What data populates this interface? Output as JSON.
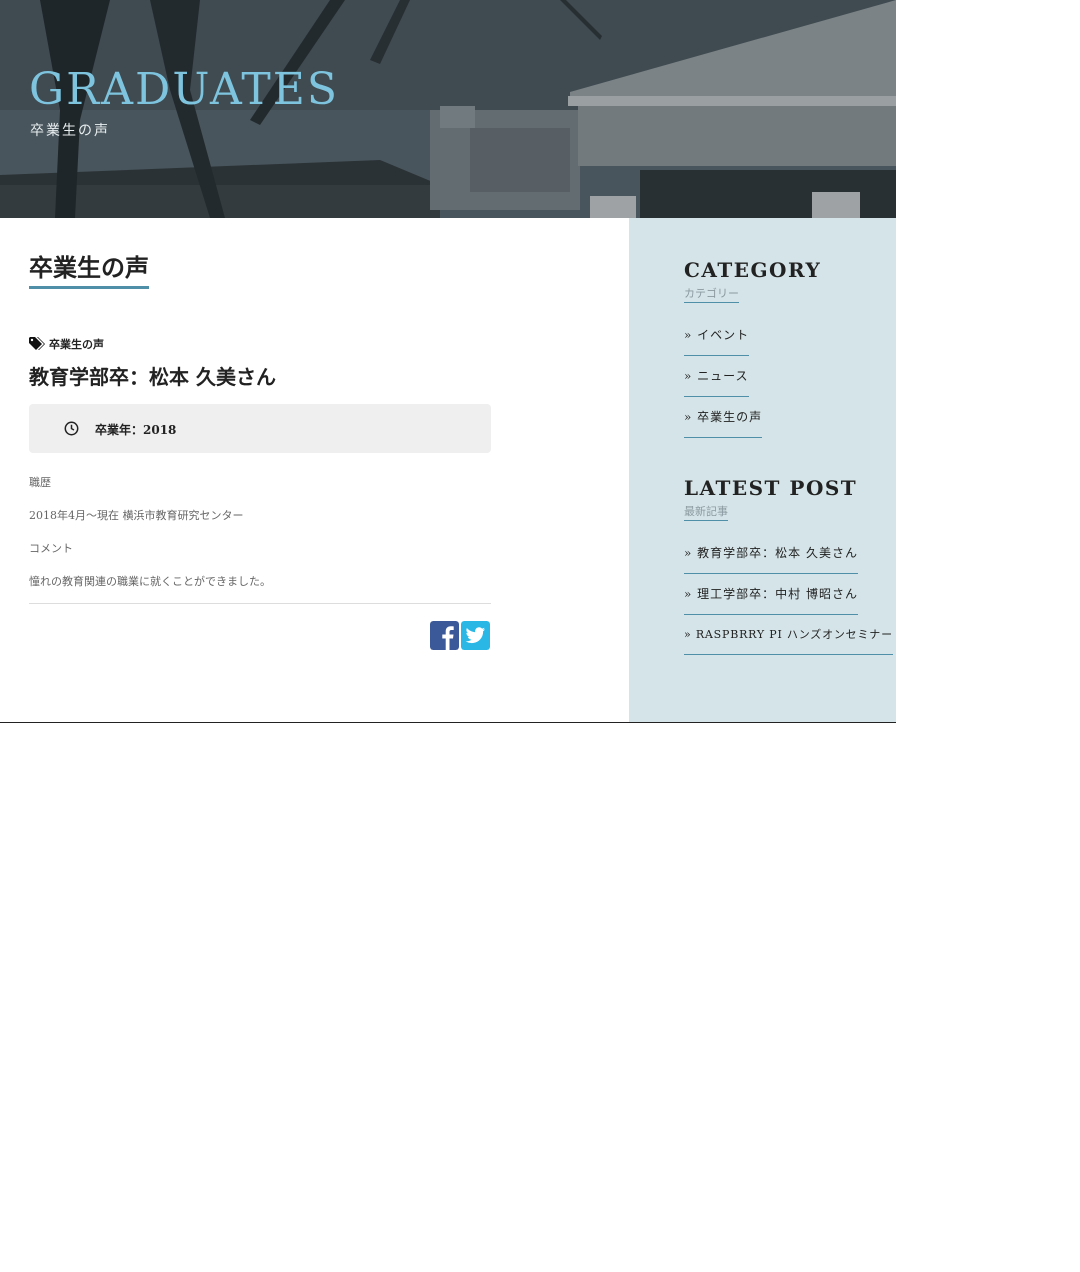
{
  "hero": {
    "title": "GRADUATES",
    "subtitle": "卒業生の声"
  },
  "main": {
    "section_title": "卒業生の声",
    "category_tag": "卒業生の声",
    "post_title": "教育学部卒：松本 久美さん",
    "graduation_year": "卒業年：2018",
    "career_label": "職歴",
    "career_text": "2018年4月～現在 横浜市教育研究センター",
    "comment_label": "コメント",
    "comment_text": "憧れの教育関連の職業に就くことができました。"
  },
  "sidebar": {
    "category": {
      "heading": "CATEGORY",
      "subheading": "カテゴリー",
      "items": [
        "» イベント",
        "» ニュース",
        "» 卒業生の声"
      ]
    },
    "latest": {
      "heading": "LATEST POST",
      "subheading": "最新記事",
      "items": [
        "» 教育学部卒：松本 久美さん",
        "» 理工学部卒：中村 博昭さん",
        "» RASPBRRY PI ハンズオンセミナー"
      ]
    }
  },
  "colors": {
    "accent": "#4f90a8",
    "hero_title": "#7ec4df",
    "sidebar_bg": "#d5e4e8",
    "facebook": "#3b5998",
    "twitter": "#2bb7e6"
  },
  "icons": [
    "tag-icon",
    "clock-icon",
    "facebook-icon",
    "twitter-icon"
  ]
}
